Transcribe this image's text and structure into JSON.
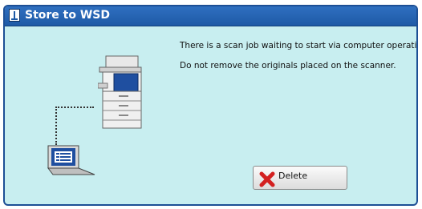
{
  "window": {
    "title": "Store to WSD"
  },
  "message": {
    "line1": "There is a scan job waiting to start via computer operation.",
    "line2": "Do not remove the originals placed on the scanner."
  },
  "actions": {
    "delete_label": "Delete"
  },
  "icons": {
    "title": "info-icon",
    "printer": "multifunction-printer-icon",
    "computer": "laptop-icon",
    "delete": "red-x-icon"
  },
  "colors": {
    "titlebar": "#1e5aa6",
    "panel_bg": "#c8eef0",
    "delete_icon": "#d32020"
  }
}
